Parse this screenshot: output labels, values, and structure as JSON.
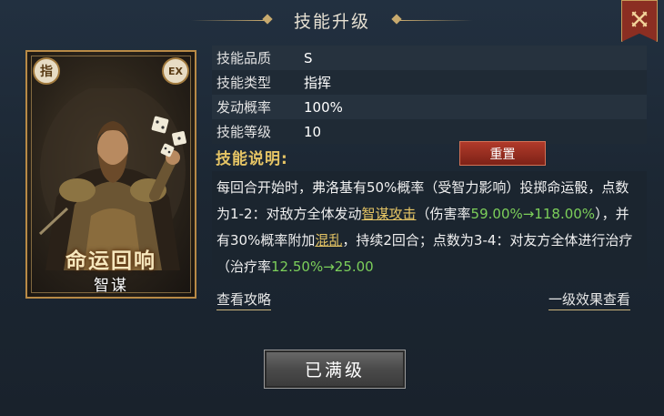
{
  "title": "技能升级",
  "close_icon": "close-crossed-swords-icon",
  "card": {
    "corner_left": "指",
    "corner_right": "EX",
    "skill_name": "命运回响",
    "skill_category": "智谋"
  },
  "attributes": [
    {
      "label": "技能品质",
      "value": "S"
    },
    {
      "label": "技能类型",
      "value": "指挥"
    },
    {
      "label": "发动概率",
      "value": "100%"
    },
    {
      "label": "技能等级",
      "value": "10"
    }
  ],
  "description": {
    "header": "技能说明:",
    "reset_label": "重置",
    "segments": [
      {
        "text": "每回合开始时，弗洛基有50%概率（受智力影响）投掷命运骰，点数为1-2：对敌方全体发动",
        "style": "normal"
      },
      {
        "text": "智谋攻击",
        "style": "keyword"
      },
      {
        "text": "（伤害率",
        "style": "normal"
      },
      {
        "text": "59.00%→118.00%",
        "style": "highlight"
      },
      {
        "text": "），并有30%概率附加",
        "style": "normal"
      },
      {
        "text": "混乱",
        "style": "keyword"
      },
      {
        "text": "，持续2回合；点数为3-4：对友方全体进行治疗（治疗率",
        "style": "normal"
      },
      {
        "text": "12.50%→25.00",
        "style": "highlight"
      }
    ]
  },
  "links": {
    "guide": "查看攻略",
    "level1_effect": "一级效果查看"
  },
  "action_button": "已满级",
  "colors": {
    "accent_gold": "#e6c565",
    "highlight_green": "#7ccf5a",
    "reset_red": "#b13a2a"
  }
}
